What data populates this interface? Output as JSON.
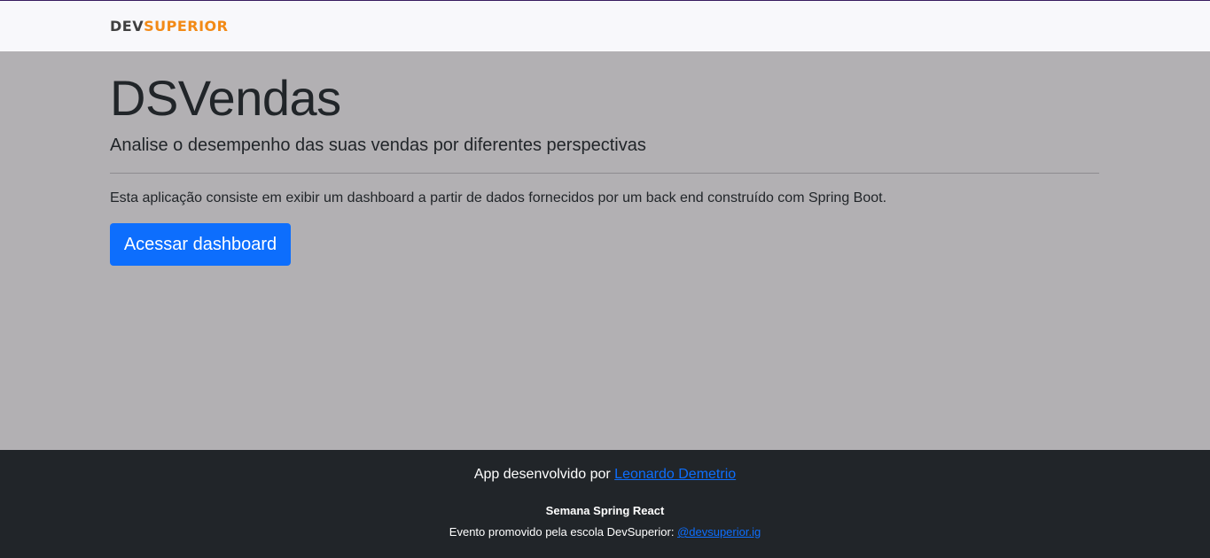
{
  "navbar": {
    "logo_part1": "DEV",
    "logo_part2": "SUPERIOR",
    "logo_colors": {
      "dev": "#404040",
      "superior": "#f28a16"
    }
  },
  "hero": {
    "title": "DSVendas",
    "lead": "Analise o desempenho das suas vendas por diferentes perspectivas",
    "description": "Esta aplicação consiste em exibir um dashboard a partir de dados fornecidos por um back end construído com Spring Boot.",
    "button_label": "Acessar dashboard",
    "button_color": "#0d6efd"
  },
  "footer": {
    "developed_by_text": "App desenvolvido por ",
    "developer_link": "Leonardo Demetrio",
    "event_title": "Semana Spring React",
    "event_text": "Evento promovido pela escola DevSuperior: ",
    "event_link": "@devsuperior.ig",
    "background": "#212529",
    "link_color": "#0d6efd"
  }
}
